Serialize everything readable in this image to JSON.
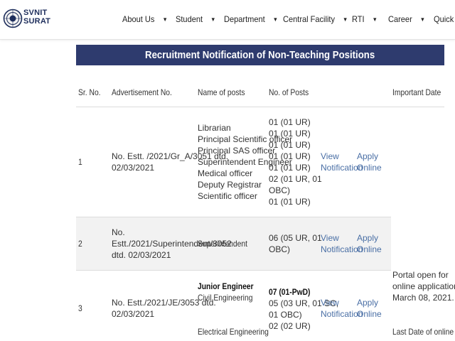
{
  "header": {
    "brand_line1": "SVNIT",
    "brand_line2": "SURAT",
    "nav": [
      {
        "label": "About Us"
      },
      {
        "label": "Student"
      },
      {
        "label": "Department"
      },
      {
        "label": "Central Facility"
      },
      {
        "label": "RTI"
      },
      {
        "label": "Career"
      },
      {
        "label": "Quick L"
      }
    ]
  },
  "banner": {
    "title": "Recruitment Notification of Non-Teaching Positions"
  },
  "table": {
    "headers": {
      "sr": "Sr. No.",
      "adv": "Advertisement No.",
      "posts": "Name of posts",
      "count": "No. of Posts",
      "date": "Important Date"
    },
    "rows": [
      {
        "sr": "1",
        "adv_line1": "No. Estt. /2021/Gr_A/3051 dtd.",
        "adv_line2": "02/03/2021",
        "posts": [
          "Librarian",
          "Principal Scientific officer",
          "Principal SAS officer",
          "Superintendent Engineer",
          "Medical officer",
          "Deputy Registrar",
          "Scientific officer"
        ],
        "counts": [
          "01 (01 UR)",
          "01 (01 UR)",
          "01 (01 UR)",
          "01 (01 UR)",
          "01 (01 UR)",
          "02 (01 UR, 01",
          "OBC)",
          "01 (01 UR)"
        ],
        "view1": "View",
        "view2": "Notification",
        "apply1": "Apply",
        "apply2": "Online"
      },
      {
        "sr": "2",
        "adv_line1": "No.",
        "adv_line2": "Estt./2021/Superintendent/3052",
        "adv_line3": "dtd. 02/03/2021",
        "post": "Superintendent",
        "count_line1": "06 (05 UR, 01",
        "count_line2": "OBC)",
        "view1": "View",
        "view2": "Notification",
        "apply1": "Apply",
        "apply2": "Online"
      },
      {
        "sr": "3",
        "adv_line1": "No. Estt./2021/JE/3053 dtd.",
        "adv_line2": "02/03/2021",
        "post_heading": "Junior Engineer",
        "post_civil": "Civil Engineering",
        "post_elec": "Electrical Engineering",
        "count_heading": "07 (01-PwD)",
        "count_line1": "05 (03 UR, 01 SC,",
        "count_line2": "01 OBC)",
        "count_line3": "02 (02 UR)",
        "view1": "View",
        "view2": "Notification",
        "apply1": "Apply",
        "apply2": "Online",
        "date_line1": "Portal open for",
        "date_line2": "online application:",
        "date_line3": "March 08, 2021.",
        "date_line4": "Last Date of online"
      }
    ]
  }
}
